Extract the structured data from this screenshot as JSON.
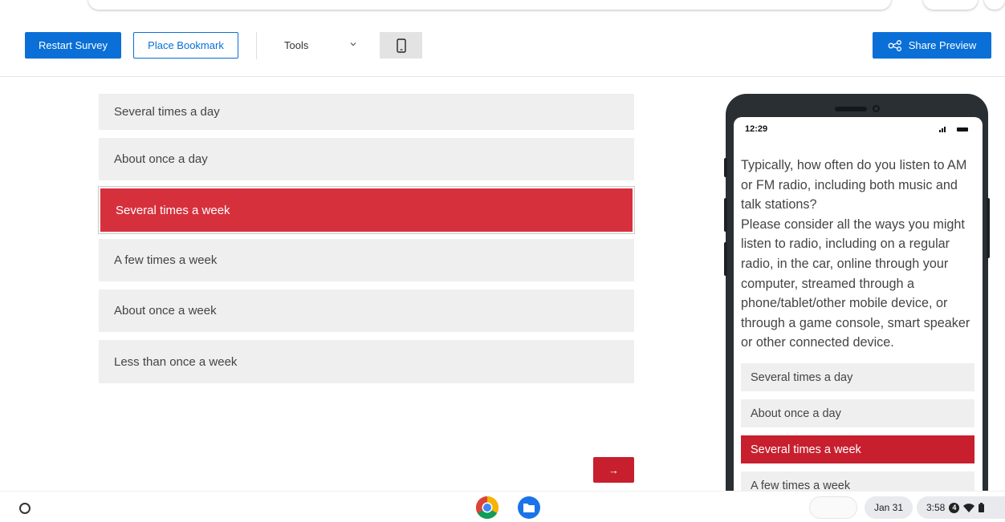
{
  "toolbar": {
    "restart_label": "Restart Survey",
    "bookmark_label": "Place Bookmark",
    "tools_label": "Tools",
    "share_label": "Share Preview",
    "device_icon": "phone-icon"
  },
  "answers": [
    {
      "label": "Several times a day",
      "selected": false
    },
    {
      "label": "About once a day",
      "selected": false
    },
    {
      "label": "Several times a week",
      "selected": true
    },
    {
      "label": "A few times a week",
      "selected": false
    },
    {
      "label": "About once a week",
      "selected": false
    },
    {
      "label": "Less than once a week",
      "selected": false
    }
  ],
  "next_label": "→",
  "phone": {
    "time": "12:29",
    "question": "Typically, how often do you listen to AM or FM radio, including both music and talk stations?",
    "instruction": "Please consider all the ways you might listen to radio, including on a regular radio, in the car, online through your computer, streamed through a phone/tablet/other mobile device, or through a game console, smart speaker or other connected device.",
    "options": [
      {
        "label": "Several times a day",
        "selected": false
      },
      {
        "label": "About once a day",
        "selected": false
      },
      {
        "label": "Several times a week",
        "selected": true
      },
      {
        "label": "A few times a week",
        "selected": false
      }
    ]
  },
  "shelf": {
    "date": "Jan 31",
    "time": "3:58",
    "notification_count": "4"
  },
  "colors": {
    "primary": "#0a6fd6",
    "selected": "#d7303d",
    "next": "#c81f2e",
    "option_bg": "#efefef"
  }
}
